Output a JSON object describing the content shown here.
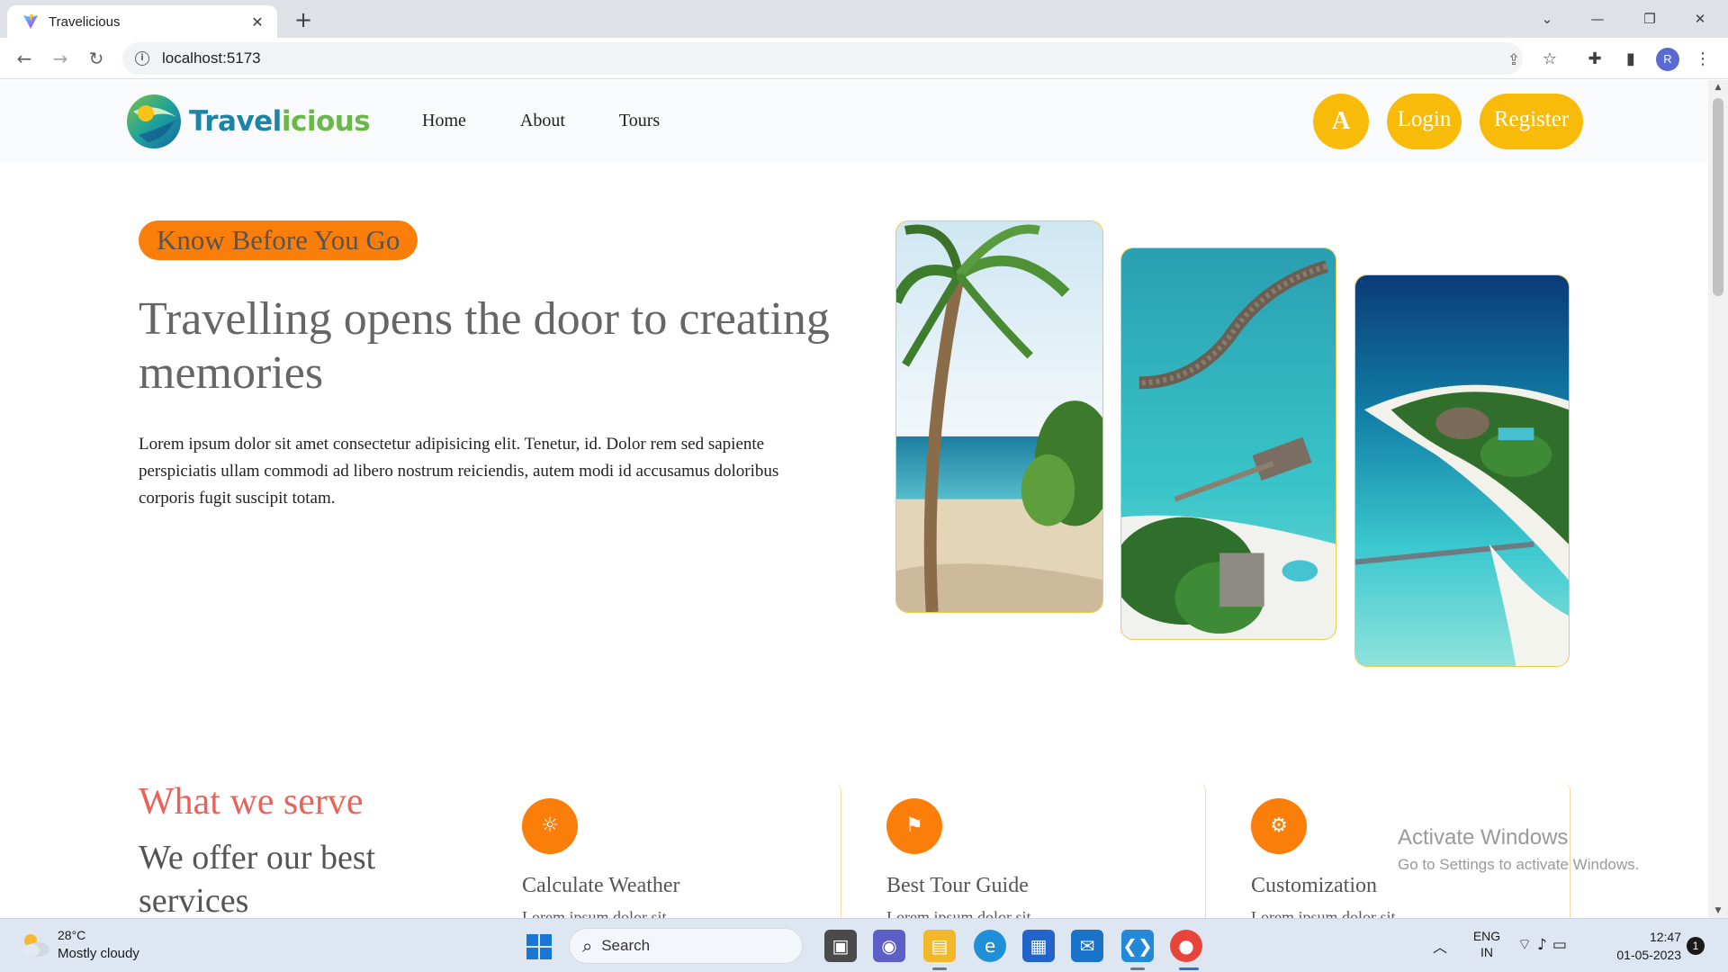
{
  "browser": {
    "tab_title": "Travelicious",
    "url": "localhost:5173",
    "profile_initial": "R"
  },
  "site": {
    "logo_text_main": "Travel",
    "logo_text_tail": "icious",
    "nav": [
      "Home",
      "About",
      "Tours"
    ],
    "avatar_letter": "A",
    "login_label": "Login",
    "register_label": "Register"
  },
  "hero": {
    "subtitle": "Know Before You Go",
    "title": "Travelling opens the door to creating memories",
    "description": "Lorem ipsum dolor sit amet consectetur adipisicing elit. Tenetur, id. Dolor rem sed sapiente perspiciatis ullam commodi ad libero nostrum reiciendis, autem modi id accusamus doloribus corporis fugit suscipit totam."
  },
  "services": {
    "title": "What we serve",
    "subtitle": "We offer our best services",
    "cards": [
      {
        "title": "Calculate Weather",
        "text": "Lorem ipsum dolor sit",
        "icon": "weather-icon"
      },
      {
        "title": "Best Tour Guide",
        "text": "Lorem ipsum dolor sit",
        "icon": "guide-icon"
      },
      {
        "title": "Customization",
        "text": "Lorem ipsum dolor sit",
        "icon": "gear-icon"
      }
    ]
  },
  "watermark": {
    "line1": "Activate Windows",
    "line2": "Go to Settings to activate Windows."
  },
  "taskbar": {
    "weather_temp": "28°C",
    "weather_desc": "Mostly cloudy",
    "search_label": "Search",
    "lang_line1": "ENG",
    "lang_line2": "IN",
    "time": "12:47",
    "date": "01-05-2023",
    "notification_count": "1"
  },
  "colors": {
    "accent_orange": "#fb7d0a",
    "accent_yellow": "#f9bb0a",
    "serve_red": "#e8645a",
    "logo_blue": "#1d84a8",
    "logo_green": "#6ab84a"
  }
}
